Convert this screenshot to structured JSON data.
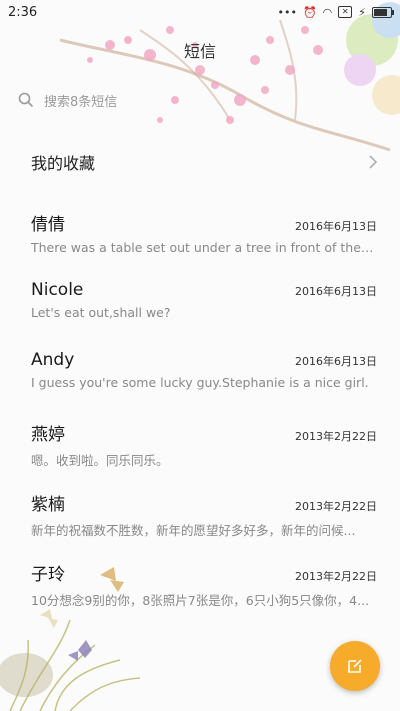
{
  "status_bar": {
    "time": "2:36",
    "battery_level": 0.8
  },
  "header": {
    "title": "短信"
  },
  "search": {
    "placeholder": "搜索8条短信"
  },
  "favorites": {
    "label": "我的收藏"
  },
  "conversations": [
    {
      "name": "倩倩",
      "date": "2016年6月13日",
      "preview": "There was a table set out under a tree in front of the ho..."
    },
    {
      "name": "Nicole",
      "date": "2016年6月13日",
      "preview": "Let's eat out,shall we?"
    },
    {
      "name": "Andy",
      "date": "2016年6月13日",
      "preview": "I guess you're some lucky guy.Stephanie is a nice girl."
    },
    {
      "name": "燕婷",
      "date": "2013年2月22日",
      "preview": "嗯。收到啦。同乐同乐。"
    },
    {
      "name": "紫楠",
      "date": "2013年2月22日",
      "preview": "新年的祝福数不胜数，新年的愿望好多好多，新年的问候..."
    },
    {
      "name": "子玲",
      "date": "2013年2月22日",
      "preview": "10分想念9别的你，8张照片7张是你，6只小狗5只像你，4..."
    }
  ],
  "colors": {
    "fab": "#f6ab2b",
    "blossom": "#f2a9c4"
  },
  "icons": {
    "search": "search-icon",
    "chevron": "chevron-right-icon",
    "compose": "compose-icon"
  }
}
